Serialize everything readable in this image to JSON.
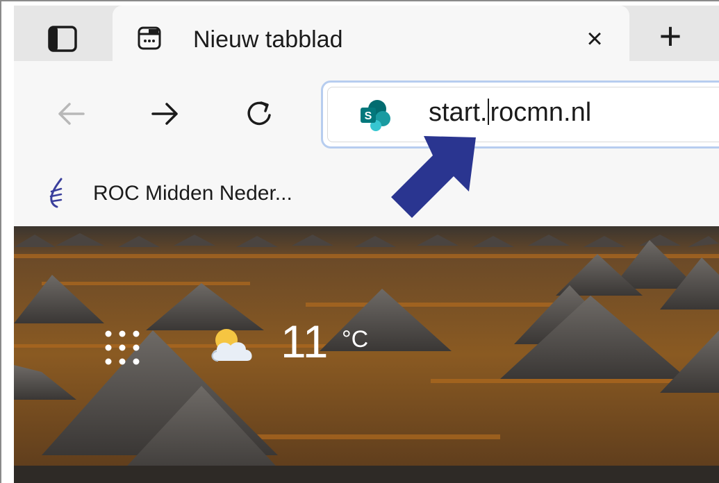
{
  "colors": {
    "tab_active": "#f7f7f7",
    "tab_strip": "#e6e6e6",
    "omnibox_border": "#b7cdef",
    "annotation_arrow": "#2a3590",
    "sharepoint_teal": "#03787c"
  },
  "tabs": [
    {
      "title": "Nieuw tabblad",
      "icon": "new-tab-page-icon"
    }
  ],
  "tab_strip": {
    "close_label": "×",
    "new_tab_label": "+",
    "actions_icon": "tab-actions-icon"
  },
  "toolbar": {
    "back_icon": "back-arrow-icon",
    "forward_icon": "forward-arrow-icon",
    "refresh_icon": "refresh-icon"
  },
  "omnibox": {
    "url_before_caret": "start.",
    "url_after_caret": "rocmn.nl",
    "site_icon": "sharepoint-icon"
  },
  "favorites": [
    {
      "label": "ROC Midden Neder...",
      "icon": "roc-logo-icon"
    }
  ],
  "new_tab_page": {
    "apps_icon": "app-launcher-icon",
    "weather_icon": "partly-cloudy-icon",
    "temperature": "11",
    "unit": "°C"
  }
}
